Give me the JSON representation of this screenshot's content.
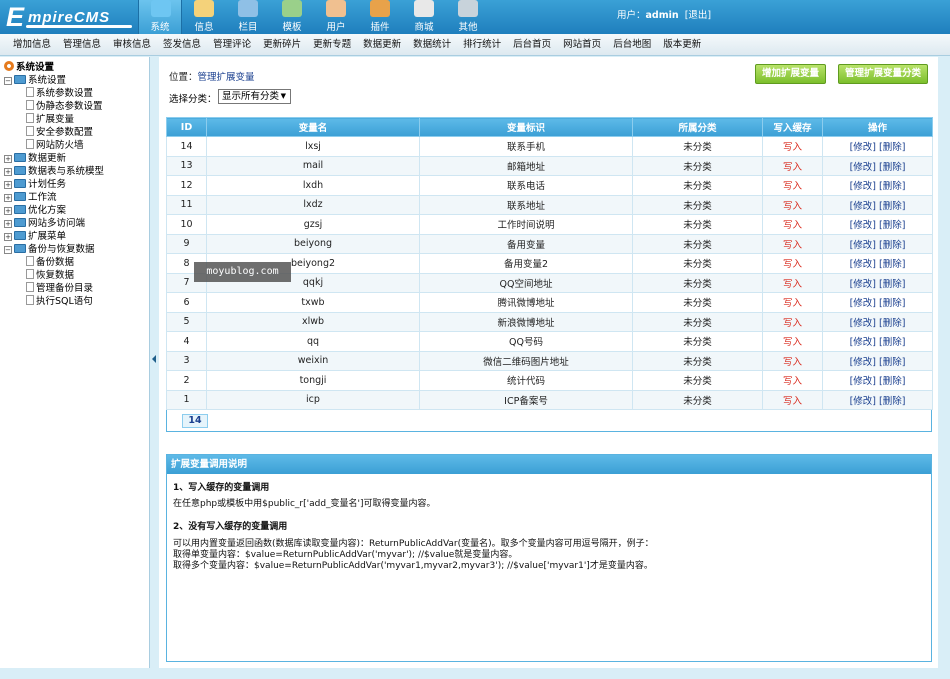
{
  "header": {
    "logo": "EmpireCMS",
    "nav": [
      {
        "label": "系统",
        "icon": "globe-icon",
        "color": "#6ec6f2",
        "active": true
      },
      {
        "label": "信息",
        "icon": "pencil-icon",
        "color": "#f4d27a"
      },
      {
        "label": "栏目",
        "icon": "folder-icon",
        "color": "#8fc0e6"
      },
      {
        "label": "模板",
        "icon": "template-icon",
        "color": "#9ad08a"
      },
      {
        "label": "用户",
        "icon": "user-icon",
        "color": "#f0c090"
      },
      {
        "label": "插件",
        "icon": "tools-icon",
        "color": "#e8a24a"
      },
      {
        "label": "商城",
        "icon": "store-icon",
        "color": "#e8e8e8"
      },
      {
        "label": "其他",
        "icon": "gear-icon",
        "color": "#c8d3db"
      }
    ],
    "user_prefix": "用户：",
    "username": "admin",
    "logout": "[退出]"
  },
  "submenu": [
    "增加信息",
    "管理信息",
    "审核信息",
    "签发信息",
    "管理评论",
    "更新碎片",
    "更新专题",
    "数据更新",
    "数据统计",
    "排行统计",
    "后台首页",
    "网站首页",
    "后台地图",
    "版本更新"
  ],
  "sidebar": {
    "root": "系统设置",
    "nodes": [
      {
        "label": "系统设置",
        "level": 0,
        "type": "folder-open"
      },
      {
        "label": "系统参数设置",
        "level": 1,
        "type": "page"
      },
      {
        "label": "伪静态参数设置",
        "level": 1,
        "type": "page"
      },
      {
        "label": "扩展变量",
        "level": 1,
        "type": "page"
      },
      {
        "label": "安全参数配置",
        "level": 1,
        "type": "page"
      },
      {
        "label": "网站防火墙",
        "level": 1,
        "type": "page"
      },
      {
        "label": "数据更新",
        "level": 0,
        "type": "folder"
      },
      {
        "label": "数据表与系统模型",
        "level": 0,
        "type": "folder"
      },
      {
        "label": "计划任务",
        "level": 0,
        "type": "folder"
      },
      {
        "label": "工作流",
        "level": 0,
        "type": "folder"
      },
      {
        "label": "优化方案",
        "level": 0,
        "type": "folder"
      },
      {
        "label": "网站多访问端",
        "level": 0,
        "type": "folder"
      },
      {
        "label": "扩展菜单",
        "level": 0,
        "type": "folder"
      },
      {
        "label": "备份与恢复数据",
        "level": 0,
        "type": "folder-open"
      },
      {
        "label": "备份数据",
        "level": 1,
        "type": "page"
      },
      {
        "label": "恢复数据",
        "level": 1,
        "type": "page"
      },
      {
        "label": "管理备份目录",
        "level": 1,
        "type": "page"
      },
      {
        "label": "执行SQL语句",
        "level": 1,
        "type": "page"
      }
    ]
  },
  "main": {
    "location_prefix": "位置：",
    "location_link": "管理扩展变量",
    "add_button": "增加扩展变量",
    "manage_category_button": "管理扩展变量分类",
    "filter_label": "选择分类：",
    "filter_value": "显示所有分类"
  },
  "table": {
    "columns": [
      "ID",
      "变量名",
      "变量标识",
      "所属分类",
      "写入缓存",
      "操作"
    ],
    "rows": [
      {
        "id": "14",
        "name": "lxsj",
        "label": "联系手机",
        "category": "未分类",
        "cache": "写入",
        "edit": "[修改]",
        "delete": "[删除]"
      },
      {
        "id": "13",
        "name": "mail",
        "label": "邮箱地址",
        "category": "未分类",
        "cache": "写入",
        "edit": "[修改]",
        "delete": "[删除]"
      },
      {
        "id": "12",
        "name": "lxdh",
        "label": "联系电话",
        "category": "未分类",
        "cache": "写入",
        "edit": "[修改]",
        "delete": "[删除]"
      },
      {
        "id": "11",
        "name": "lxdz",
        "label": "联系地址",
        "category": "未分类",
        "cache": "写入",
        "edit": "[修改]",
        "delete": "[删除]"
      },
      {
        "id": "10",
        "name": "gzsj",
        "label": "工作时间说明",
        "category": "未分类",
        "cache": "写入",
        "edit": "[修改]",
        "delete": "[删除]"
      },
      {
        "id": "9",
        "name": "beiyong",
        "label": "备用变量",
        "category": "未分类",
        "cache": "写入",
        "edit": "[修改]",
        "delete": "[删除]"
      },
      {
        "id": "8",
        "name": "beiyong2",
        "label": "备用变量2",
        "category": "未分类",
        "cache": "写入",
        "edit": "[修改]",
        "delete": "[删除]"
      },
      {
        "id": "7",
        "name": "qqkj",
        "label": "QQ空间地址",
        "category": "未分类",
        "cache": "写入",
        "edit": "[修改]",
        "delete": "[删除]"
      },
      {
        "id": "6",
        "name": "txwb",
        "label": "腾讯微博地址",
        "category": "未分类",
        "cache": "写入",
        "edit": "[修改]",
        "delete": "[删除]"
      },
      {
        "id": "5",
        "name": "xlwb",
        "label": "新浪微博地址",
        "category": "未分类",
        "cache": "写入",
        "edit": "[修改]",
        "delete": "[删除]"
      },
      {
        "id": "4",
        "name": "qq",
        "label": "QQ号码",
        "category": "未分类",
        "cache": "写入",
        "edit": "[修改]",
        "delete": "[删除]"
      },
      {
        "id": "3",
        "name": "weixin",
        "label": "微信二维码图片地址",
        "category": "未分类",
        "cache": "写入",
        "edit": "[修改]",
        "delete": "[删除]"
      },
      {
        "id": "2",
        "name": "tongji",
        "label": "统计代码",
        "category": "未分类",
        "cache": "写入",
        "edit": "[修改]",
        "delete": "[删除]"
      },
      {
        "id": "1",
        "name": "icp",
        "label": "ICP备案号",
        "category": "未分类",
        "cache": "写入",
        "edit": "[修改]",
        "delete": "[删除]"
      }
    ],
    "pager": "14"
  },
  "info": {
    "title": "扩展变量调用说明",
    "h1": "1、写入缓存的变量调用",
    "p1": "在任意php或模板中用$public_r['add_变量名']可取得变量内容。",
    "h2": "2、没有写入缓存的变量调用",
    "p2": "可以用内置变量返回函数(数据库读取变量内容)：ReturnPublicAddVar(变量名)。取多个变量内容可用逗号隔开，例子：",
    "p3": "取得单变量内容：$value=ReturnPublicAddVar('myvar'); //$value就是变量内容。",
    "p4": "取得多个变量内容：$value=ReturnPublicAddVar('myvar1,myvar2,myvar3'); //$value['myvar1']才是变量内容。"
  },
  "watermark": "moyublog.com"
}
